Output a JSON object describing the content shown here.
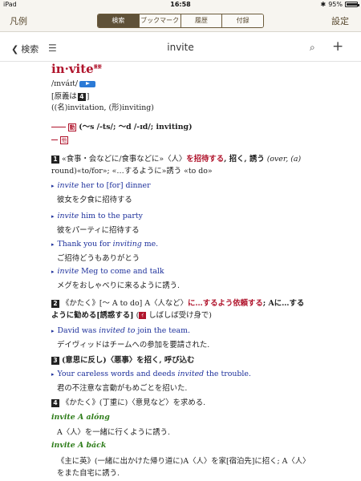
{
  "status": {
    "carrier": "iPad",
    "time": "16:58",
    "battery": "95%",
    "battery_level": 0.95
  },
  "toolbar": {
    "left": "凡例",
    "right": "設定",
    "tabs": [
      "検索",
      "ブックマーク",
      "履歴",
      "付録"
    ],
    "active_tab": 0
  },
  "nav": {
    "back": "検索",
    "title": "invite"
  },
  "entry": {
    "headword": "in·vite",
    "headword_mark": "重要",
    "pron": "/ɪnváɪt/",
    "gen_note_a": "[原義は",
    "gen_note_num": "4",
    "gen_note_b": "]",
    "derivs": "((名)invitation, (形)inviting)",
    "verb_tag": "動",
    "verb_forms": "(〜s /-ts/; 〜d /-ɪd/; inviting)",
    "other_tag": "他",
    "s1_num": "1",
    "s1_line1_a": "«食事・会などに/食事などに»〈人〉",
    "s1_line1_red": "を招待する",
    "s1_line1_b": ", 招く, 誘う",
    "s1_line1_c": "(over, (a)",
    "s1_line2": "round)«to/for»; «…するように»誘う «to do»",
    "ex1_en_a": "invite",
    "ex1_en_b": " her to [for] dinner",
    "ex1_ja": "彼女を夕食に招待する",
    "ex2_en_a": "invite",
    "ex2_en_b": " him to the party",
    "ex2_ja": "彼をパーティに招待する",
    "ex3_en_a": "Thank you for ",
    "ex3_en_b": "inviting",
    "ex3_en_c": " me.",
    "ex3_ja": "ご招待どうもありがとう",
    "ex4_en_a": "invite",
    "ex4_en_b": " Meg to come and talk",
    "ex4_ja": "メグをおしゃべりに来るように誘う.",
    "s2_num": "2",
    "s2_line1_a": "《かたく》[〜 A to do] A〈人など〉",
    "s2_line1_red": "に…するよう依頼する",
    "s2_line1_b": "; Aに…する",
    "s2_line2_a": "ように勧める[誘惑する]",
    "s2_line2_tag": "ｲ",
    "s2_line2_b": " しばしば受け身で)",
    "ex5_en_a": "David was ",
    "ex5_en_b": "invited to",
    "ex5_en_c": " join the team.",
    "ex5_ja": "デイヴィッドはチームへの参加を要請された.",
    "s3_num": "3",
    "s3_text": "(意思に反し)〈悪事〉を招く, 呼び込む",
    "ex6_en_a": "Your careless words and deeds ",
    "ex6_en_b": "invited",
    "ex6_en_c": " the trouble.",
    "ex6_ja": "君の不注意な言動がもめごとを招いた.",
    "s4_num": "4",
    "s4_text": "《かたく》(丁重に)〈意見など〉を求める.",
    "ph1": "invite A alóng",
    "ph1_ja": "A〈人〉を一緒に行くように誘う.",
    "ph2": "invite A báck",
    "ph2_ja1": "《主に英》(一緒に出かけた帰り道に)A〈人〉を家[宿泊先]に招く; A〈人〉",
    "ph2_ja2": "をまた自宅に誘う."
  }
}
